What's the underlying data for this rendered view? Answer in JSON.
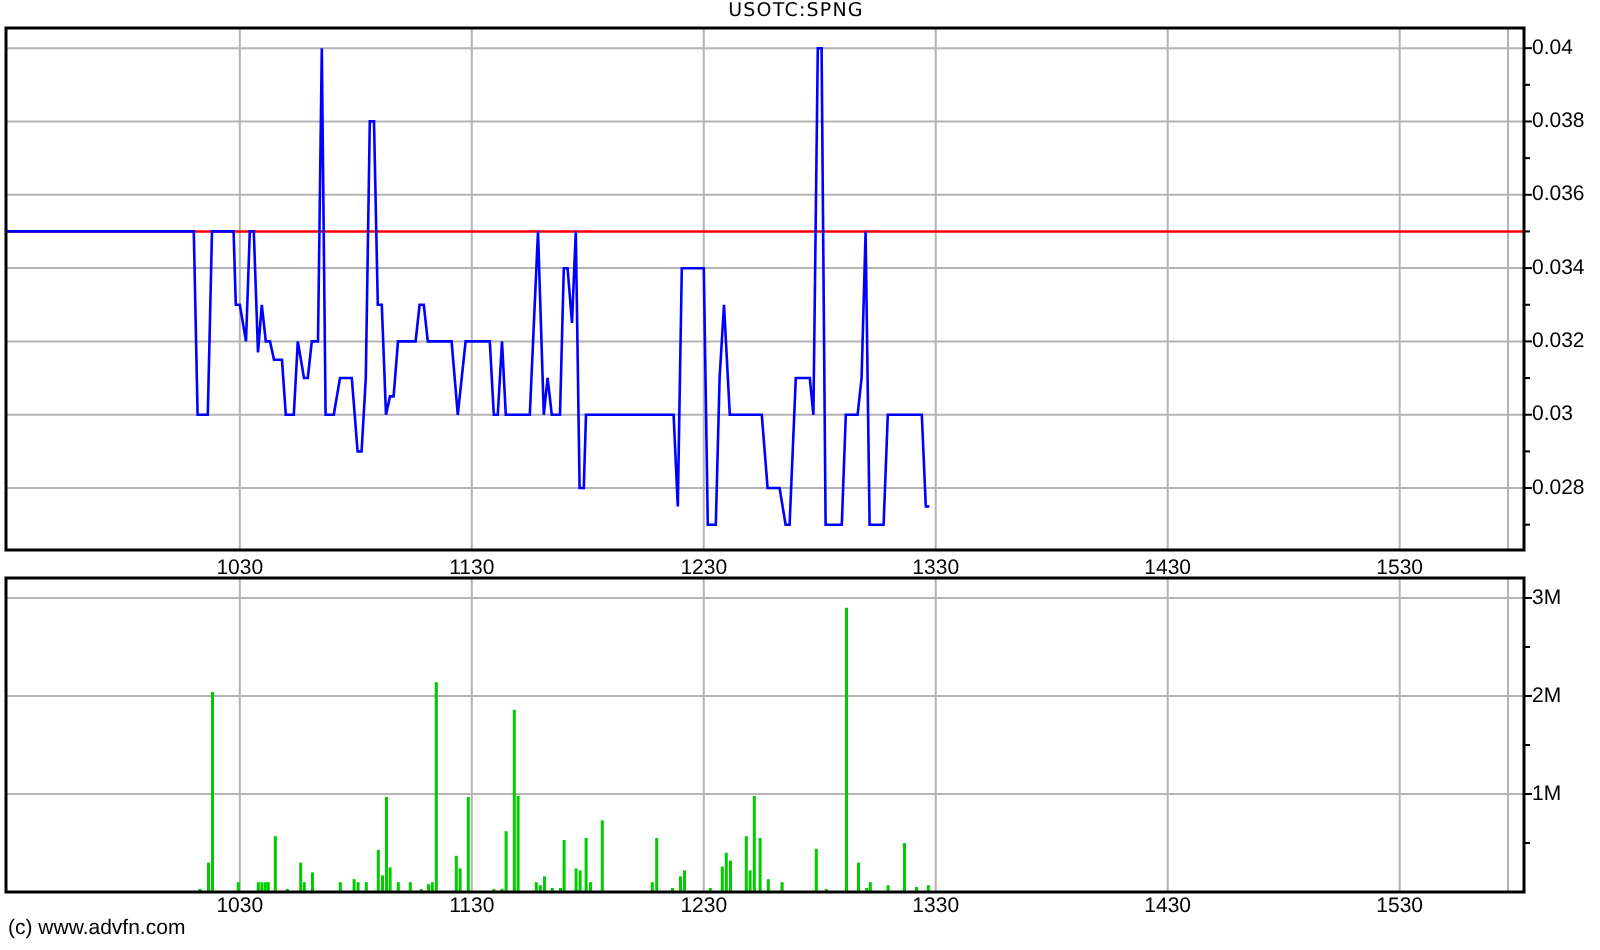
{
  "price_chart": {
    "chart_data": {
      "type": "line",
      "title": "USOTC:SPNG",
      "x": [
        929.2,
        1010.2,
        1011.8,
        1016.2,
        1018,
        1027.3,
        1028.3,
        1030,
        1032.7,
        1034.3,
        1036,
        1037.8,
        1039.5,
        1041.2,
        1043,
        1044.7,
        1048.2,
        1049.8,
        1053.3,
        1055,
        1057.7,
        1059.3,
        1061,
        1063.7,
        1065.3,
        1067,
        1070.5,
        1073.2,
        1078.3,
        1080.8,
        1082.5,
        1084.3,
        1086,
        1087.8,
        1089.5,
        1091.2,
        1093,
        1094.7,
        1096.3,
        1098.2,
        1105.8,
        1107.5,
        1109.3,
        1111,
        1121.3,
        1124,
        1127.3,
        1137.8,
        1139.5,
        1141.2,
        1143,
        1144.7,
        1155,
        1158.5,
        1161,
        1162.7,
        1164.5,
        1168,
        1169.7,
        1171.3,
        1173.2,
        1174.8,
        1176.5,
        1178.3,
        1179.2,
        1217,
        1218.8,
        1220.5,
        1230,
        1231.7,
        1235.2,
        1236.8,
        1238.7,
        1241.2,
        1255,
        1257.5,
        1262.7,
        1265.3,
        1267,
        1269.7,
        1275.7,
        1277.3,
        1279.2,
        1280.8,
        1282.5,
        1289.5,
        1291.2,
        1296.3,
        1298,
        1299.8,
        1301.5,
        1307.5,
        1309.3,
        1324,
        1325.7,
        1327.3
      ],
      "series": [
        {
          "color": "#0000ff",
          "values": [
            0.035,
            0.035,
            0.03,
            0.03,
            0.035,
            0.035,
            0.033,
            0.033,
            0.032,
            0.035,
            0.035,
            0.0317,
            0.033,
            0.032,
            0.032,
            0.0315,
            0.0315,
            0.03,
            0.03,
            0.032,
            0.031,
            0.031,
            0.032,
            0.032,
            0.04,
            0.03,
            0.03,
            0.031,
            0.031,
            0.029,
            0.029,
            0.031,
            0.038,
            0.038,
            0.033,
            0.033,
            0.03,
            0.0305,
            0.0305,
            0.032,
            0.032,
            0.033,
            0.033,
            0.032,
            0.032,
            0.03,
            0.032,
            0.032,
            0.03,
            0.03,
            0.032,
            0.03,
            0.03,
            0.035,
            0.03,
            0.031,
            0.03,
            0.03,
            0.034,
            0.034,
            0.0325,
            0.035,
            0.028,
            0.028,
            0.03,
            0.03,
            0.0275,
            0.034,
            0.034,
            0.027,
            0.027,
            0.031,
            0.033,
            0.03,
            0.03,
            0.028,
            0.028,
            0.027,
            0.027,
            0.031,
            0.031,
            0.03,
            0.04,
            0.04,
            0.027,
            0.027,
            0.03,
            0.03,
            0.031,
            0.035,
            0.027,
            0.027,
            0.03,
            0.03,
            0.0275,
            0.0275
          ]
        }
      ],
      "xlim": [
        929.2,
        1576.7
      ],
      "ylim": [
        0.02631,
        0.04055
      ],
      "xticks": [
        1030,
        1130,
        1230,
        1330,
        1430,
        1530
      ],
      "yticks": [
        0.028,
        0.03,
        0.032,
        0.034,
        0.036,
        0.038,
        0.04
      ],
      "grid": true,
      "ref_lines": [
        {
          "axis": "y",
          "value": 0.035,
          "color": "#ff0000"
        }
      ]
    }
  },
  "volume_chart": {
    "chart_data": {
      "type": "bar",
      "x": [
        1012.8,
        1016.5,
        1018.2,
        1029.3,
        1038,
        1039.5,
        1041,
        1042.3,
        1045.3,
        1050.5,
        1056.2,
        1057.8,
        1061.3,
        1073.3,
        1079.3,
        1081,
        1084.5,
        1089.7,
        1091.5,
        1093.2,
        1094.8,
        1098.3,
        1103.5,
        1108.2,
        1111.3,
        1113,
        1114.7,
        1123.3,
        1125,
        1128.5,
        1139.5,
        1143,
        1144.8,
        1148.3,
        1150,
        1157.8,
        1159.5,
        1161.3,
        1164.7,
        1168.2,
        1169.8,
        1175,
        1176.7,
        1179.3,
        1181.2,
        1186.3,
        1207.8,
        1209.7,
        1216.5,
        1220,
        1221.7,
        1232.8,
        1238,
        1239.7,
        1241.5,
        1248.3,
        1250,
        1251.8,
        1254.3,
        1257.8,
        1263.8,
        1278.5,
        1282.8,
        1291.5,
        1296.7,
        1300.2,
        1301.8,
        1309.5,
        1316.5,
        1321.7,
        1326.8
      ],
      "series": [
        {
          "color": "#00cc00",
          "values": [
            30000,
            300000,
            2040000,
            100000,
            100000,
            100000,
            100000,
            100000,
            570000,
            30000,
            300000,
            100000,
            200000,
            100000,
            130000,
            100000,
            100000,
            430000,
            170000,
            970000,
            250000,
            100000,
            100000,
            30000,
            80000,
            100000,
            2140000,
            370000,
            240000,
            970000,
            30000,
            30000,
            620000,
            1860000,
            980000,
            100000,
            70000,
            160000,
            40000,
            40000,
            530000,
            240000,
            220000,
            550000,
            100000,
            730000,
            100000,
            550000,
            40000,
            160000,
            220000,
            40000,
            260000,
            400000,
            320000,
            570000,
            220000,
            980000,
            550000,
            130000,
            100000,
            440000,
            30000,
            2900000,
            300000,
            40000,
            100000,
            70000,
            500000,
            50000,
            70000
          ]
        }
      ],
      "xlim": [
        929.2,
        1576.7
      ],
      "ylim": [
        0,
        3204000
      ],
      "xticks": [
        1030,
        1130,
        1230,
        1330,
        1430,
        1530
      ],
      "grid": true,
      "yticks": [
        {
          "value": 1000000,
          "label": "1M"
        },
        {
          "value": 2000000,
          "label": "2M"
        },
        {
          "value": 3000000,
          "label": "3M"
        }
      ]
    }
  },
  "footer": {
    "copyright": "(c) www.advfn.com"
  }
}
